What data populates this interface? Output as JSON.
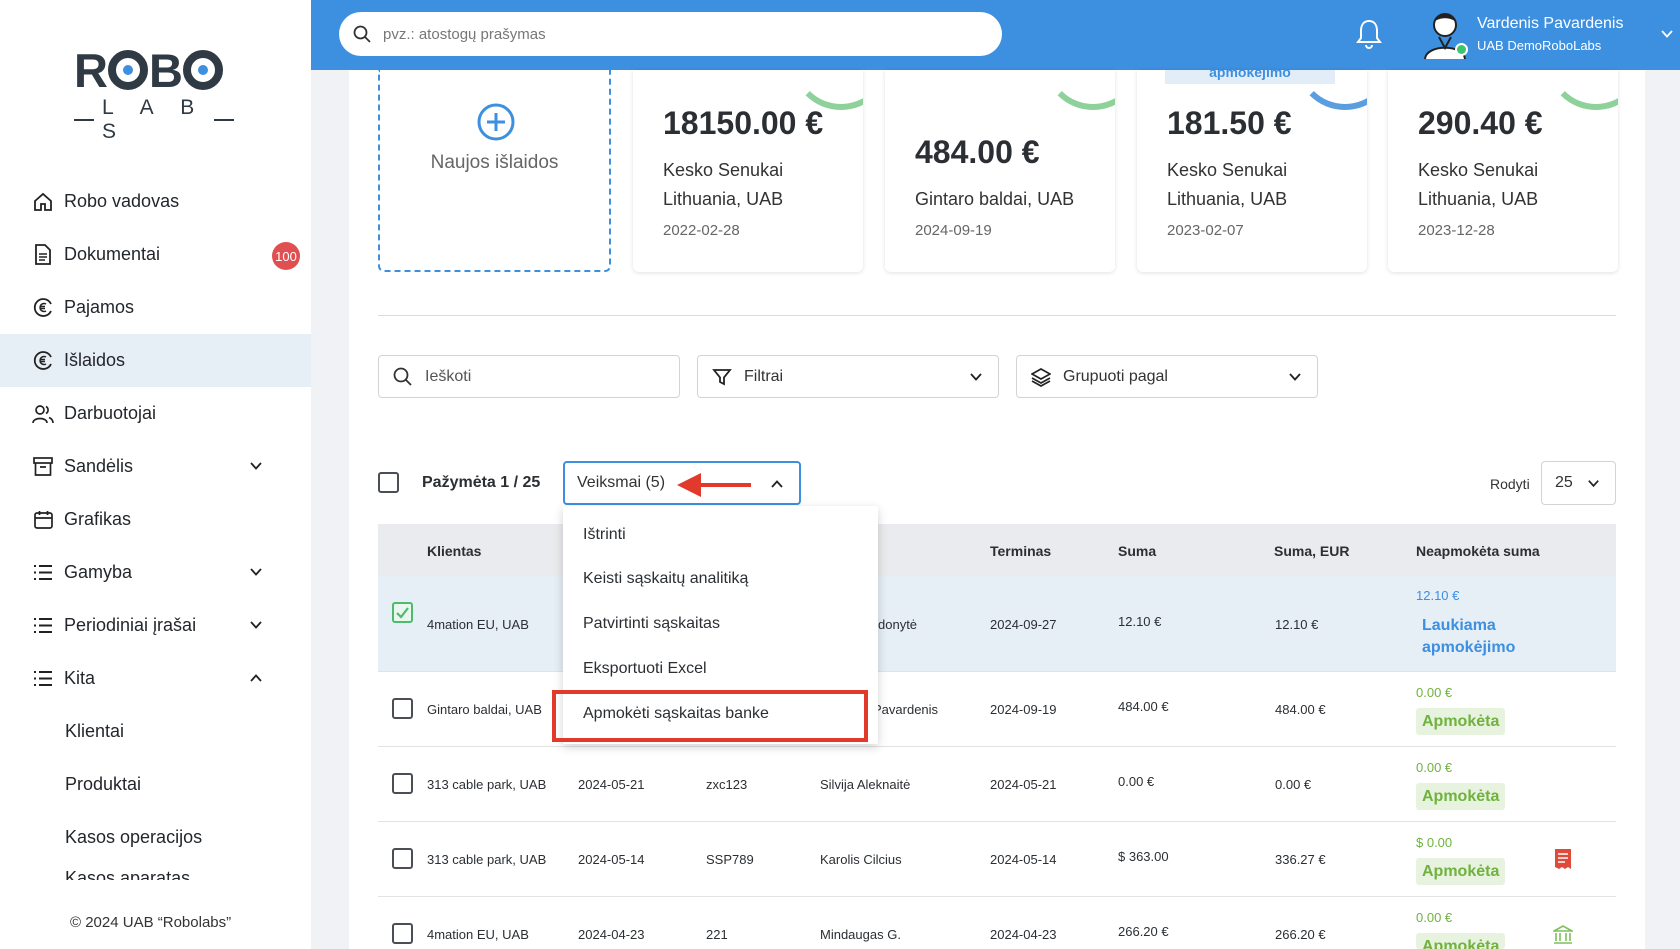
{
  "sidebar": {
    "logo_top": "ROBO",
    "logo_bottom": "LABS",
    "items": [
      {
        "label": "Robo vadovas",
        "icon": "home-icon"
      },
      {
        "label": "Dokumentai",
        "icon": "document-icon",
        "badge": "100"
      },
      {
        "label": "Pajamos",
        "icon": "euro-coin-icon"
      },
      {
        "label": "Išlaidos",
        "icon": "euro-coin-icon",
        "active": true
      },
      {
        "label": "Darbuotojai",
        "icon": "users-icon"
      },
      {
        "label": "Sandėlis",
        "icon": "archive-icon",
        "expandable": true
      },
      {
        "label": "Grafikas",
        "icon": "calendar-icon"
      },
      {
        "label": "Gamyba",
        "icon": "list-icon",
        "expandable": true
      },
      {
        "label": "Periodiniai įrašai",
        "icon": "list-icon",
        "expandable": true
      },
      {
        "label": "Kita",
        "icon": "list-icon",
        "expanded": true
      }
    ],
    "sub_items": [
      "Klientai",
      "Produktai",
      "Kasos operacijos",
      "Kasos aparatas"
    ],
    "copyright": "© 2024 UAB “Robolabs”"
  },
  "header": {
    "search_placeholder": "pvz.: atostogų prašymas",
    "user_name": "Vardenis Pavardenis",
    "user_company": "UAB DemoRoboLabs"
  },
  "cards": {
    "new_label": "Naujos išlaidos",
    "items": [
      {
        "amount": "18150.00 €",
        "name": "Kesko Senukai Lithuania, UAB",
        "date": "2022-02-28"
      },
      {
        "amount": "484.00 €",
        "name": "Gintaro baldai, UAB",
        "date": "2024-09-19"
      },
      {
        "amount": "181.50 €",
        "name": "Kesko Senukai Lithuania, UAB",
        "date": "2023-02-07",
        "tag": "apmokėjimo"
      },
      {
        "amount": "290.40 €",
        "name": "Kesko Senukai Lithuania, UAB",
        "date": "2023-12-28"
      }
    ]
  },
  "controls": {
    "search_placeholder": "Ieškoti",
    "filters_label": "Filtrai",
    "group_label": "Grupuoti pagal",
    "selected_label": "Pažymėta 1 / 25",
    "actions_label": "Veiksmai (5)",
    "show_label": "Rodyti",
    "show_value": "25"
  },
  "dropdown": {
    "items": [
      "Ištrinti",
      "Keisti sąskaitų analitiką",
      "Patvirtinti sąskaitas",
      "Eksportuoti Excel",
      "Apmokėti sąskaitas banke"
    ]
  },
  "table": {
    "headers": {
      "client": "Klientas",
      "term": "Terminas",
      "sum": "Suma",
      "sum_eur": "Suma, EUR",
      "unpaid": "Neapmokėta suma"
    },
    "rows": [
      {
        "client": "4mation EU, UAB",
        "date": "",
        "number": "",
        "person": "donytė",
        "term": "2024-09-27",
        "sum": "12.10 €",
        "sum_eur": "12.10 €",
        "unpaid": "12.10 €",
        "status": "Laukiama apmokėjimo",
        "selected": true
      },
      {
        "client": "Gintaro baldai, UAB",
        "date": "",
        "number": "",
        "person": "Pavardenis",
        "term": "2024-09-19",
        "sum": "484.00 €",
        "sum_eur": "484.00 €",
        "unpaid": "0.00 €",
        "status": "Apmokėta"
      },
      {
        "client": "313 cable park, UAB",
        "date": "2024-05-21",
        "number": "zxc123",
        "person": "Silvija Aleknaitė",
        "term": "2024-05-21",
        "sum": "0.00 €",
        "sum_eur": "0.00 €",
        "unpaid": "0.00 €",
        "status": "Apmokėta"
      },
      {
        "client": "313 cable park, UAB",
        "date": "2024-05-14",
        "number": "SSP789",
        "person": "Karolis Cilcius",
        "term": "2024-05-14",
        "sum": "$ 363.00",
        "sum_eur": "336.27 €",
        "unpaid": "$ 0.00",
        "status": "Apmokėta",
        "icon": "receipt-icon"
      },
      {
        "client": "4mation EU, UAB",
        "date": "2024-04-23",
        "number": "221",
        "person": "Mindaugas G.",
        "term": "2024-04-23",
        "sum": "266.20 €",
        "sum_eur": "266.20 €",
        "unpaid": "0.00 €",
        "status": "Apmokėta",
        "icon": "bank-icon"
      }
    ]
  },
  "colors": {
    "primary": "#3d8fe0",
    "badge": "#e05050",
    "paid": "#6fb23e",
    "highlight": "#e13a2a"
  }
}
